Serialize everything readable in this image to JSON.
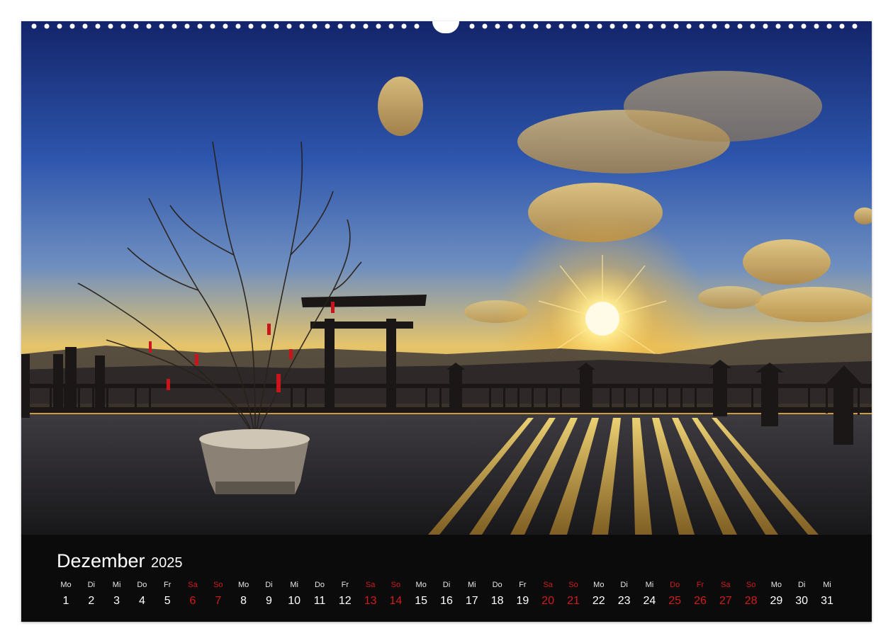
{
  "calendar": {
    "month": "Dezember",
    "year": "2025",
    "weekend_color": "#d21c1c",
    "days": [
      {
        "weekday": "Mo",
        "day": "1",
        "weekend": false
      },
      {
        "weekday": "Di",
        "day": "2",
        "weekend": false
      },
      {
        "weekday": "Mi",
        "day": "3",
        "weekend": false
      },
      {
        "weekday": "Do",
        "day": "4",
        "weekend": false
      },
      {
        "weekday": "Fr",
        "day": "5",
        "weekend": false
      },
      {
        "weekday": "Sa",
        "day": "6",
        "weekend": true
      },
      {
        "weekday": "So",
        "day": "7",
        "weekend": true
      },
      {
        "weekday": "Mo",
        "day": "8",
        "weekend": false
      },
      {
        "weekday": "Di",
        "day": "9",
        "weekend": false
      },
      {
        "weekday": "Mi",
        "day": "10",
        "weekend": false
      },
      {
        "weekday": "Do",
        "day": "11",
        "weekend": false
      },
      {
        "weekday": "Fr",
        "day": "12",
        "weekend": false
      },
      {
        "weekday": "Sa",
        "day": "13",
        "weekend": true
      },
      {
        "weekday": "So",
        "day": "14",
        "weekend": true
      },
      {
        "weekday": "Mo",
        "day": "15",
        "weekend": false
      },
      {
        "weekday": "Di",
        "day": "16",
        "weekend": false
      },
      {
        "weekday": "Mi",
        "day": "17",
        "weekend": false
      },
      {
        "weekday": "Do",
        "day": "18",
        "weekend": false
      },
      {
        "weekday": "Fr",
        "day": "19",
        "weekend": false
      },
      {
        "weekday": "Sa",
        "day": "20",
        "weekend": true
      },
      {
        "weekday": "So",
        "day": "21",
        "weekend": true
      },
      {
        "weekday": "Mo",
        "day": "22",
        "weekend": false
      },
      {
        "weekday": "Di",
        "day": "23",
        "weekend": false
      },
      {
        "weekday": "Mi",
        "day": "24",
        "weekend": false
      },
      {
        "weekday": "Do",
        "day": "25",
        "weekend": true
      },
      {
        "weekday": "Fr",
        "day": "26",
        "weekend": true
      },
      {
        "weekday": "Sa",
        "day": "27",
        "weekend": true
      },
      {
        "weekday": "So",
        "day": "28",
        "weekend": true
      },
      {
        "weekday": "Mo",
        "day": "29",
        "weekend": false
      },
      {
        "weekday": "Di",
        "day": "30",
        "weekend": false
      },
      {
        "weekday": "Mi",
        "day": "31",
        "weekend": false
      }
    ]
  },
  "photo": {
    "subject": "sunrise-temple-terrace",
    "sky_top_color": "#1a2f7a",
    "sky_mid_color": "#3a64b8",
    "horizon_color": "#f2c24a",
    "sun_color": "#fff6c8",
    "floor_color": "#2b2a2c"
  }
}
